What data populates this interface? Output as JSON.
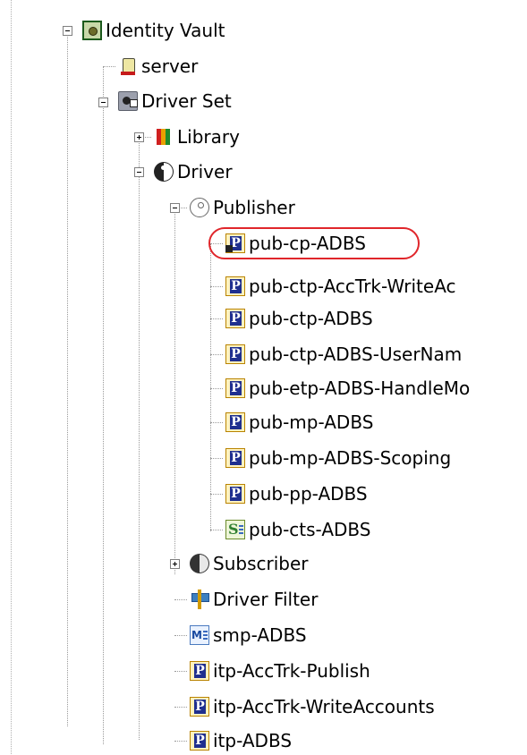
{
  "tree": {
    "identity_vault": "Identity Vault",
    "server": "server",
    "driver_set": "Driver Set",
    "library": "Library",
    "driver": "Driver",
    "publisher": "Publisher",
    "publisher_children": [
      "pub-cp-ADBS",
      "pub-ctp-AccTrk-WriteAc",
      "pub-ctp-ADBS",
      "pub-ctp-ADBS-UserNam",
      "pub-etp-ADBS-HandleMo",
      "pub-mp-ADBS",
      "pub-mp-ADBS-Scoping",
      "pub-pp-ADBS",
      "pub-cts-ADBS"
    ],
    "subscriber": "Subscriber",
    "driver_filter": "Driver Filter",
    "smp": "smp-ADBS",
    "itp_1": "itp-AccTrk-Publish",
    "itp_2": "itp-AccTrk-WriteAccounts",
    "itp_3": "itp-ADBS"
  },
  "selection": {
    "highlighted_item": "pub-cp-ADBS",
    "highlight_color": "#e0262b"
  },
  "icons": {
    "identity_vault": "identity-vault-icon",
    "server": "server-icon",
    "driver_set": "driver-set-icon",
    "library": "library-icon",
    "driver": "driver-icon",
    "publisher": "publisher-icon",
    "policy": "policy-P-icon",
    "stylesheet": "stylesheet-S-icon",
    "subscriber": "subscriber-icon",
    "filter": "driver-filter-icon",
    "mapping": "mapping-M-icon"
  }
}
